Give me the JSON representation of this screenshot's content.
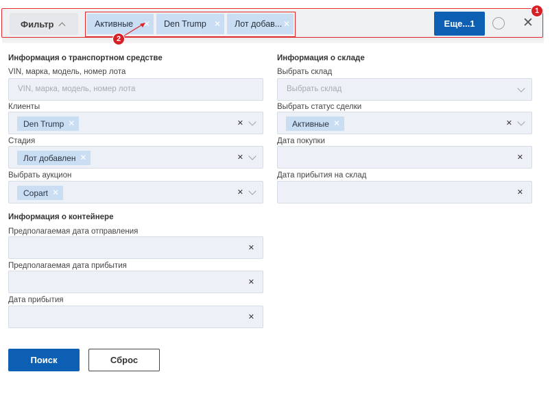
{
  "topbar": {
    "filter_label": "Фильтр",
    "chips": [
      {
        "label": "Активные"
      },
      {
        "label": "Den Trump"
      },
      {
        "label": "Лот добав..."
      }
    ],
    "more_label": "Еще...1",
    "annotations": [
      "1",
      "2"
    ]
  },
  "vehicle": {
    "title": "Информация о транспортном средстве",
    "vin_label": "VIN, марка, модель, номер лота",
    "vin_placeholder": "VIN, марка, модель, номер лота",
    "clients_label": "Клиенты",
    "clients_value": "Den Trump",
    "stage_label": "Стадия",
    "stage_value": "Лот добавлен",
    "auction_label": "Выбрать аукцион",
    "auction_value": "Copart"
  },
  "warehouse": {
    "title": "Информация о складе",
    "warehouse_label": "Выбрать склад",
    "warehouse_placeholder": "Выбрать склад",
    "deal_status_label": "Выбрать статус сделки",
    "deal_status_value": "Активные",
    "purchase_date_label": "Дата покупки",
    "arrival_wh_label": "Дата прибытия на склад"
  },
  "container": {
    "title": "Информация о контейнере",
    "departure_label": "Предполагаемая дата отправления",
    "est_arrival_label": "Предполагаемая дата прибытия",
    "arrival_label": "Дата прибытия"
  },
  "actions": {
    "search_label": "Поиск",
    "reset_label": "Сброс"
  },
  "colors": {
    "primary": "#0d5fb3",
    "chip": "#c9ddf3",
    "field_bg": "#edf1f7",
    "annotation": "#e1262b"
  }
}
